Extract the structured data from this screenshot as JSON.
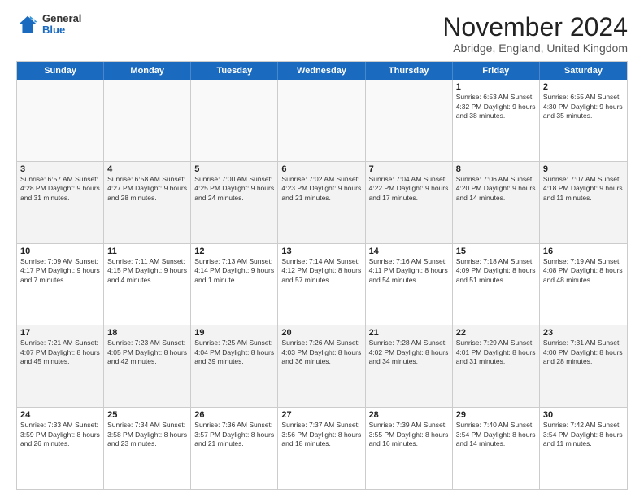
{
  "header": {
    "logo_general": "General",
    "logo_blue": "Blue",
    "month_title": "November 2024",
    "location": "Abridge, England, United Kingdom"
  },
  "days_of_week": [
    "Sunday",
    "Monday",
    "Tuesday",
    "Wednesday",
    "Thursday",
    "Friday",
    "Saturday"
  ],
  "rows": [
    {
      "alt": false,
      "cells": [
        {
          "day": "",
          "info": ""
        },
        {
          "day": "",
          "info": ""
        },
        {
          "day": "",
          "info": ""
        },
        {
          "day": "",
          "info": ""
        },
        {
          "day": "",
          "info": ""
        },
        {
          "day": "1",
          "info": "Sunrise: 6:53 AM\nSunset: 4:32 PM\nDaylight: 9 hours and 38 minutes."
        },
        {
          "day": "2",
          "info": "Sunrise: 6:55 AM\nSunset: 4:30 PM\nDaylight: 9 hours and 35 minutes."
        }
      ]
    },
    {
      "alt": true,
      "cells": [
        {
          "day": "3",
          "info": "Sunrise: 6:57 AM\nSunset: 4:28 PM\nDaylight: 9 hours and 31 minutes."
        },
        {
          "day": "4",
          "info": "Sunrise: 6:58 AM\nSunset: 4:27 PM\nDaylight: 9 hours and 28 minutes."
        },
        {
          "day": "5",
          "info": "Sunrise: 7:00 AM\nSunset: 4:25 PM\nDaylight: 9 hours and 24 minutes."
        },
        {
          "day": "6",
          "info": "Sunrise: 7:02 AM\nSunset: 4:23 PM\nDaylight: 9 hours and 21 minutes."
        },
        {
          "day": "7",
          "info": "Sunrise: 7:04 AM\nSunset: 4:22 PM\nDaylight: 9 hours and 17 minutes."
        },
        {
          "day": "8",
          "info": "Sunrise: 7:06 AM\nSunset: 4:20 PM\nDaylight: 9 hours and 14 minutes."
        },
        {
          "day": "9",
          "info": "Sunrise: 7:07 AM\nSunset: 4:18 PM\nDaylight: 9 hours and 11 minutes."
        }
      ]
    },
    {
      "alt": false,
      "cells": [
        {
          "day": "10",
          "info": "Sunrise: 7:09 AM\nSunset: 4:17 PM\nDaylight: 9 hours and 7 minutes."
        },
        {
          "day": "11",
          "info": "Sunrise: 7:11 AM\nSunset: 4:15 PM\nDaylight: 9 hours and 4 minutes."
        },
        {
          "day": "12",
          "info": "Sunrise: 7:13 AM\nSunset: 4:14 PM\nDaylight: 9 hours and 1 minute."
        },
        {
          "day": "13",
          "info": "Sunrise: 7:14 AM\nSunset: 4:12 PM\nDaylight: 8 hours and 57 minutes."
        },
        {
          "day": "14",
          "info": "Sunrise: 7:16 AM\nSunset: 4:11 PM\nDaylight: 8 hours and 54 minutes."
        },
        {
          "day": "15",
          "info": "Sunrise: 7:18 AM\nSunset: 4:09 PM\nDaylight: 8 hours and 51 minutes."
        },
        {
          "day": "16",
          "info": "Sunrise: 7:19 AM\nSunset: 4:08 PM\nDaylight: 8 hours and 48 minutes."
        }
      ]
    },
    {
      "alt": true,
      "cells": [
        {
          "day": "17",
          "info": "Sunrise: 7:21 AM\nSunset: 4:07 PM\nDaylight: 8 hours and 45 minutes."
        },
        {
          "day": "18",
          "info": "Sunrise: 7:23 AM\nSunset: 4:05 PM\nDaylight: 8 hours and 42 minutes."
        },
        {
          "day": "19",
          "info": "Sunrise: 7:25 AM\nSunset: 4:04 PM\nDaylight: 8 hours and 39 minutes."
        },
        {
          "day": "20",
          "info": "Sunrise: 7:26 AM\nSunset: 4:03 PM\nDaylight: 8 hours and 36 minutes."
        },
        {
          "day": "21",
          "info": "Sunrise: 7:28 AM\nSunset: 4:02 PM\nDaylight: 8 hours and 34 minutes."
        },
        {
          "day": "22",
          "info": "Sunrise: 7:29 AM\nSunset: 4:01 PM\nDaylight: 8 hours and 31 minutes."
        },
        {
          "day": "23",
          "info": "Sunrise: 7:31 AM\nSunset: 4:00 PM\nDaylight: 8 hours and 28 minutes."
        }
      ]
    },
    {
      "alt": false,
      "cells": [
        {
          "day": "24",
          "info": "Sunrise: 7:33 AM\nSunset: 3:59 PM\nDaylight: 8 hours and 26 minutes."
        },
        {
          "day": "25",
          "info": "Sunrise: 7:34 AM\nSunset: 3:58 PM\nDaylight: 8 hours and 23 minutes."
        },
        {
          "day": "26",
          "info": "Sunrise: 7:36 AM\nSunset: 3:57 PM\nDaylight: 8 hours and 21 minutes."
        },
        {
          "day": "27",
          "info": "Sunrise: 7:37 AM\nSunset: 3:56 PM\nDaylight: 8 hours and 18 minutes."
        },
        {
          "day": "28",
          "info": "Sunrise: 7:39 AM\nSunset: 3:55 PM\nDaylight: 8 hours and 16 minutes."
        },
        {
          "day": "29",
          "info": "Sunrise: 7:40 AM\nSunset: 3:54 PM\nDaylight: 8 hours and 14 minutes."
        },
        {
          "day": "30",
          "info": "Sunrise: 7:42 AM\nSunset: 3:54 PM\nDaylight: 8 hours and 11 minutes."
        }
      ]
    }
  ]
}
